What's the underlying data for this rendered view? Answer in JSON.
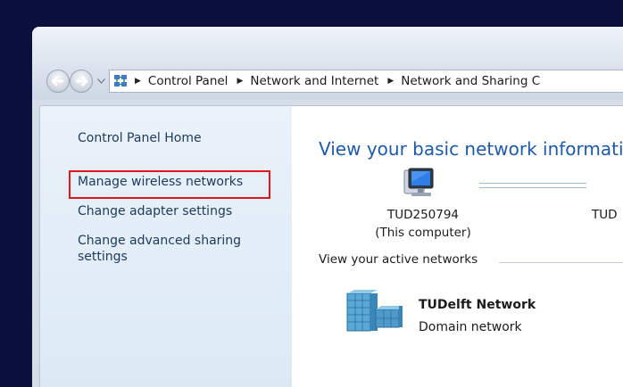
{
  "breadcrumb": {
    "items": [
      "Control Panel",
      "Network and Internet",
      "Network and Sharing C"
    ]
  },
  "icons": {
    "back": "back-arrow-icon",
    "forward": "forward-arrow-icon",
    "history": "chevron-down-icon",
    "location": "network-sharing-center-icon",
    "computer": "computer-monitor-icon",
    "network": "domain-network-icon",
    "breadcrumb_separator": "chevron-right-icon"
  },
  "sidebar": {
    "items": [
      {
        "label": "Control Panel Home"
      },
      {
        "label": "Manage wireless networks",
        "highlighted": true
      },
      {
        "label": "Change adapter settings"
      },
      {
        "label": "Change advanced sharing",
        "label2": "settings"
      }
    ]
  },
  "main": {
    "title": "View your basic network informati",
    "computer": {
      "name": "TUD250794",
      "desc": "(This computer)"
    },
    "remote_partial": "TUD",
    "active_networks_label": "View your active networks",
    "network": {
      "name": "TUDelft Network",
      "type": "Domain network"
    }
  },
  "colors": {
    "highlight": "#e0161b",
    "link": "#1e395b",
    "title": "#1e5aa8",
    "background": "#0b0f3e"
  }
}
